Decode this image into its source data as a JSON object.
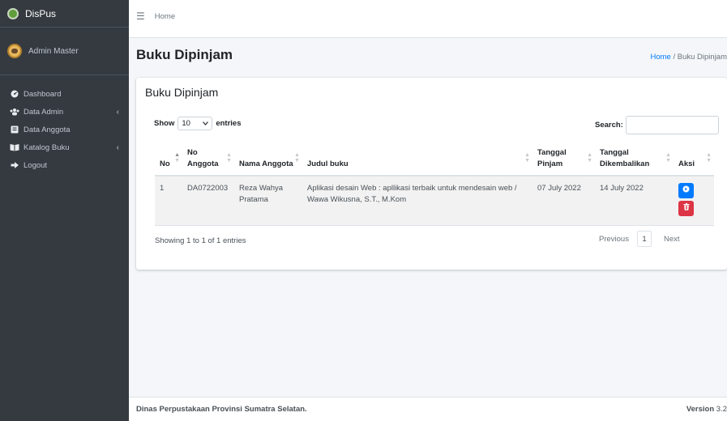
{
  "app": {
    "brand": "DisPus"
  },
  "user": {
    "name": "Admin Master"
  },
  "sidebar": {
    "items": [
      {
        "label": "Dashboard",
        "icon": "dashboard-icon",
        "chevron": ""
      },
      {
        "label": "Data Admin",
        "icon": "users-icon",
        "chevron": "‹"
      },
      {
        "label": "Data Anggota",
        "icon": "id-card-icon",
        "chevron": ""
      },
      {
        "label": "Katalog Buku",
        "icon": "book-icon",
        "chevron": "‹"
      },
      {
        "label": "Logout",
        "icon": "logout-icon",
        "chevron": ""
      }
    ]
  },
  "topbar": {
    "home": "Home"
  },
  "page": {
    "title": "Buku Dipinjam",
    "breadcrumb_home": "Home",
    "breadcrumb_sep": "/",
    "breadcrumb_current": "Buku Dipinjam"
  },
  "card": {
    "title": "Buku Dipinjam",
    "show_label": "Show",
    "entries_value": "10",
    "entries_label": "entries",
    "search_label": "Search:",
    "search_value": ""
  },
  "table": {
    "headers": [
      "No",
      "No Anggota",
      "Nama Anggota",
      "Judul buku",
      "Tanggal Pinjam",
      "Tanggal Dikembalikan",
      "Aksi"
    ],
    "rows": [
      {
        "no": "1",
        "no_anggota": "DA0722003",
        "nama": "Reza Wahya Pratama",
        "judul": "Aplikasi desain Web : apllikasi terbaik untuk mendesain web / Wawa Wikusna, S.T., M.Kom",
        "tgl_pinjam": "07 July 2022",
        "tgl_kembali": "14 July 2022"
      }
    ]
  },
  "info": "Showing 1 to 1 of 1 entries",
  "pagination": {
    "previous": "Previous",
    "page": "1",
    "next": "Next"
  },
  "footer": {
    "left": "Dinas Perpustakaan Provinsi Sumatra Selatan.",
    "version_label": "Version",
    "version": "3.2"
  },
  "colors": {
    "sidebar": "#343a40",
    "primary": "#007bff",
    "danger": "#dc3545"
  }
}
